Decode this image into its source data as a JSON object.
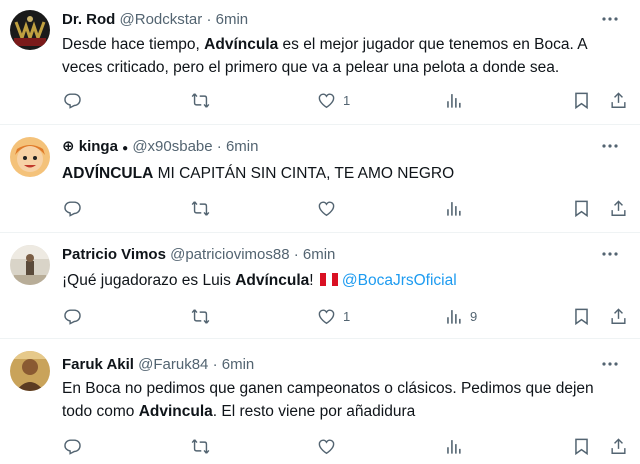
{
  "tweets": [
    {
      "name": "Dr. Rod",
      "handle": "@Rodckstar",
      "sep": "·",
      "time": "6min",
      "text": {
        "p1": "Desde hace tiempo, ",
        "b1": "Advíncula",
        "p2": " es el mejor jugador que tenemos en Boca. A veces criticado, pero el primero que va a pelear una pelota a donde sea."
      },
      "likes": "1",
      "views": ""
    },
    {
      "name": "kinga",
      "handle": "@x90sbabe",
      "sep": "·",
      "time": "6min",
      "name_prefix_icon": "globe-icon",
      "name_suffix_icon": "small-dot-icon",
      "text": {
        "b1": "ADVÍNCULA",
        "p1": " MI CAPITÁN SIN CINTA, TE AMO NEGRO"
      },
      "likes": "",
      "views": ""
    },
    {
      "name": "Patricio Vimos",
      "handle": "@patriciovimos88",
      "sep": "·",
      "time": "6min",
      "text": {
        "p1": "¡Qué jugadorazo es Luis ",
        "b1": "Advíncula",
        "p2": "! ",
        "flag": "peru-flag",
        "mention": "@BocaJrsOficial"
      },
      "likes": "1",
      "views": "9"
    },
    {
      "name": "Faruk Akil",
      "handle": "@Faruk84",
      "sep": "·",
      "time": "6min",
      "text": {
        "p1": "En Boca no pedimos que ganen campeonatos o clásicos. Pedimos que dejen todo como ",
        "b1": "Advincula",
        "p2": ". El resto viene por añadidura"
      },
      "likes": "",
      "views": ""
    }
  ],
  "colors": {
    "text": "#0f1419",
    "muted": "#536471",
    "link": "#1d9bf0",
    "divider": "#eff3f4"
  },
  "icons": [
    "reply-icon",
    "retweet-icon",
    "like-icon",
    "views-icon",
    "bookmark-icon",
    "share-icon",
    "more-icon"
  ]
}
